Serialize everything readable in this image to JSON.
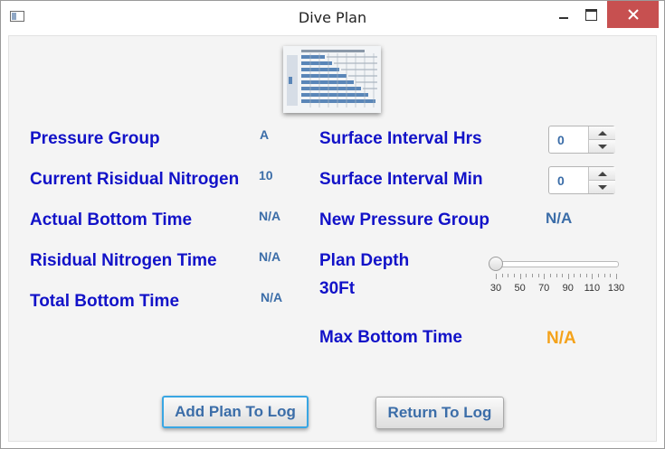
{
  "window": {
    "title": "Dive Plan"
  },
  "left": {
    "pressure_group": {
      "label": "Pressure Group",
      "value": "A"
    },
    "current_residual": {
      "label": "Current Risidual Nitrogen",
      "value": "10"
    },
    "actual_bottom": {
      "label": "Actual Bottom Time",
      "value": "N/A"
    },
    "residual_time": {
      "label": "Risidual Nitrogen Time",
      "value": "N/A"
    },
    "total_bottom": {
      "label": "Total Bottom Time",
      "value": "N/A"
    }
  },
  "right": {
    "si_hrs": {
      "label": "Surface Interval Hrs",
      "value": "0"
    },
    "si_min": {
      "label": "Surface Interval Min",
      "value": "0"
    },
    "new_group": {
      "label": "New Pressure Group",
      "value": "N/A"
    },
    "plan_depth": {
      "label": "Plan Depth",
      "value": "30Ft"
    },
    "max_bottom": {
      "label": "Max Bottom Time",
      "value": "N/A"
    }
  },
  "depth_slider": {
    "value": 30,
    "min": 30,
    "max": 130,
    "ticks": [
      "30",
      "50",
      "70",
      "90",
      "110",
      "130"
    ]
  },
  "buttons": {
    "add": "Add Plan To Log",
    "return": "Return To Log"
  },
  "colors": {
    "label": "#1212c8",
    "value": "#3b6da8",
    "max_value": "#f4a21a",
    "close": "#c75050",
    "focus": "#39a6e3"
  },
  "icons": {
    "app": "window-icon",
    "minimize": "minimize-icon",
    "maximize": "maximize-icon",
    "close": "close-icon",
    "table": "dive-table-image"
  }
}
